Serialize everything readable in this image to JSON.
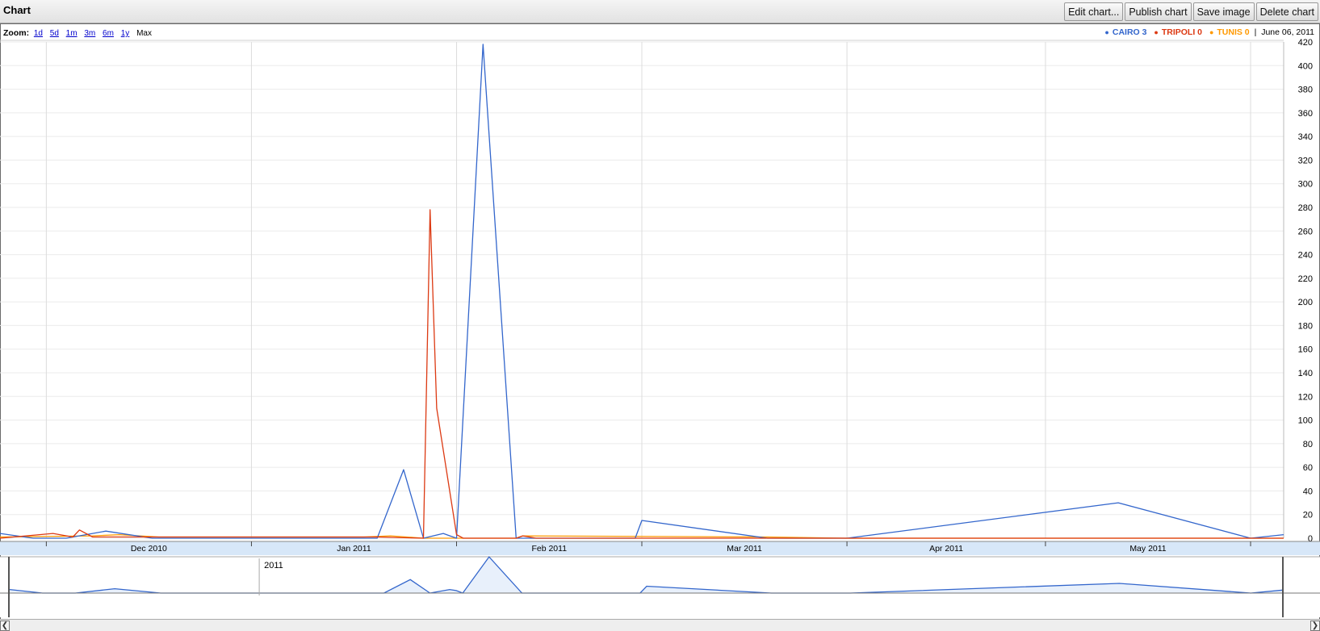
{
  "header": {
    "title": "Chart",
    "buttons": [
      "Edit chart...",
      "Publish chart",
      "Save image",
      "Delete chart"
    ]
  },
  "zoom": {
    "label": "Zoom:",
    "options": [
      "1d",
      "5d",
      "1m",
      "3m",
      "6m",
      "1y"
    ],
    "active": "Max"
  },
  "legend": {
    "items": [
      {
        "name": "CAIRO",
        "value": "3",
        "color": "#3366cc"
      },
      {
        "name": "TRIPOLI",
        "value": "0",
        "color": "#dc3912"
      },
      {
        "name": "TUNIS",
        "value": "0",
        "color": "#ff9900"
      }
    ],
    "separator": "|",
    "date": "June 06, 2011"
  },
  "chart_data": {
    "type": "line",
    "x_tick_labels": [
      "Dec 2010",
      "Jan 2011",
      "Feb 2011",
      "Mar 2011",
      "Apr 2011",
      "May 2011"
    ],
    "y_ticks": [
      0,
      20,
      40,
      60,
      80,
      100,
      120,
      140,
      160,
      180,
      200,
      220,
      240,
      260,
      280,
      300,
      320,
      340,
      360,
      380,
      400,
      420
    ],
    "ylim": [
      0,
      420
    ],
    "xlim": [
      "2010-11-24",
      "2011-06-06"
    ],
    "grid": true,
    "range_label": "2011",
    "series": [
      {
        "name": "CAIRO",
        "color": "#3366cc",
        "points": [
          [
            "2010-11-24",
            4
          ],
          [
            "2010-11-29",
            0
          ],
          [
            "2010-12-04",
            0
          ],
          [
            "2010-12-10",
            6
          ],
          [
            "2010-12-17",
            0
          ],
          [
            "2011-01-02",
            0
          ],
          [
            "2011-01-20",
            0
          ],
          [
            "2011-01-24",
            58
          ],
          [
            "2011-01-27",
            0
          ],
          [
            "2011-01-30",
            4
          ],
          [
            "2011-01-31",
            2
          ],
          [
            "2011-02-01",
            0
          ],
          [
            "2011-02-05",
            418
          ],
          [
            "2011-02-10",
            0
          ],
          [
            "2011-02-28",
            0
          ],
          [
            "2011-03-01",
            15
          ],
          [
            "2011-03-20",
            0
          ],
          [
            "2011-04-01",
            0
          ],
          [
            "2011-05-12",
            30
          ],
          [
            "2011-06-01",
            0
          ],
          [
            "2011-06-06",
            3
          ]
        ]
      },
      {
        "name": "TRIPOLI",
        "color": "#dc3912",
        "points": [
          [
            "2010-11-24",
            0
          ],
          [
            "2010-12-02",
            4
          ],
          [
            "2010-12-05",
            1
          ],
          [
            "2010-12-06",
            7
          ],
          [
            "2010-12-08",
            1
          ],
          [
            "2011-01-20",
            1
          ],
          [
            "2011-01-27",
            0
          ],
          [
            "2011-01-28",
            278
          ],
          [
            "2011-01-29",
            110
          ],
          [
            "2011-02-01",
            3
          ],
          [
            "2011-02-02",
            0
          ],
          [
            "2011-02-10",
            0
          ],
          [
            "2011-02-11",
            2
          ],
          [
            "2011-02-13",
            0
          ],
          [
            "2011-06-06",
            0
          ]
        ]
      },
      {
        "name": "TUNIS",
        "color": "#ff9900",
        "points": [
          [
            "2010-11-24",
            1
          ],
          [
            "2010-12-08",
            2
          ],
          [
            "2010-12-12",
            3
          ],
          [
            "2010-12-18",
            1
          ],
          [
            "2011-01-18",
            1
          ],
          [
            "2011-01-22",
            2
          ],
          [
            "2011-01-27",
            0
          ],
          [
            "2011-02-10",
            0
          ],
          [
            "2011-02-11",
            2
          ],
          [
            "2011-03-20",
            1
          ],
          [
            "2011-04-01",
            0
          ],
          [
            "2011-06-06",
            0
          ]
        ]
      }
    ]
  }
}
